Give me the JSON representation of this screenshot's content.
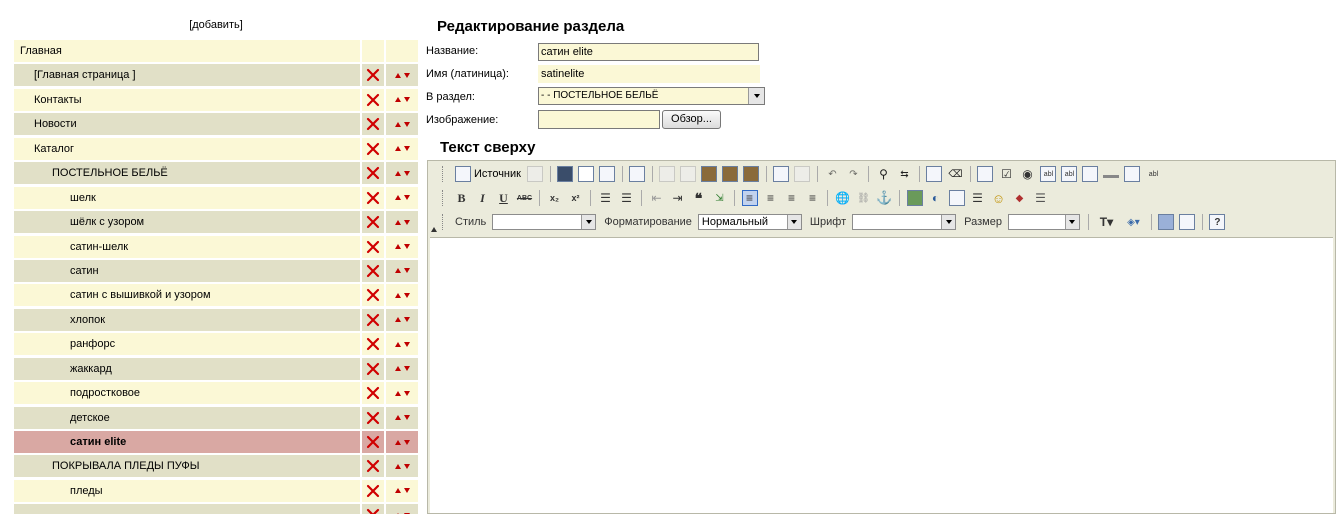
{
  "tree": {
    "add_label": "[добавить]",
    "items": [
      {
        "label": "Главная",
        "indent": 0,
        "tone": "light",
        "controls": false
      },
      {
        "label": "[Главная страница ]",
        "indent": 1,
        "tone": "dark",
        "controls": true
      },
      {
        "label": "Контакты",
        "indent": 1,
        "tone": "light",
        "controls": true
      },
      {
        "label": "Новости",
        "indent": 1,
        "tone": "dark",
        "controls": true
      },
      {
        "label": "Каталог",
        "indent": 1,
        "tone": "light",
        "controls": true
      },
      {
        "label": "ПОСТЕЛЬНОЕ БЕЛЬЁ",
        "indent": 2,
        "tone": "dark",
        "controls": true
      },
      {
        "label": "шелк",
        "indent": 3,
        "tone": "light",
        "controls": true
      },
      {
        "label": "шёлк с узором",
        "indent": 3,
        "tone": "dark",
        "controls": true
      },
      {
        "label": "сатин-шелк",
        "indent": 3,
        "tone": "light",
        "controls": true
      },
      {
        "label": "сатин",
        "indent": 3,
        "tone": "dark",
        "controls": true
      },
      {
        "label": "сатин с вышивкой и узором",
        "indent": 3,
        "tone": "light",
        "controls": true
      },
      {
        "label": "хлопок",
        "indent": 3,
        "tone": "dark",
        "controls": true
      },
      {
        "label": "ранфорс",
        "indent": 3,
        "tone": "light",
        "controls": true
      },
      {
        "label": "жаккард",
        "indent": 3,
        "tone": "dark",
        "controls": true
      },
      {
        "label": "подростковое",
        "indent": 3,
        "tone": "light",
        "controls": true
      },
      {
        "label": "детское",
        "indent": 3,
        "tone": "dark",
        "controls": true
      },
      {
        "label": "сатин elite",
        "indent": 3,
        "tone": "selected",
        "controls": true
      },
      {
        "label": "ПОКРЫВАЛА ПЛЕДЫ ПУФЫ",
        "indent": 2,
        "tone": "dark",
        "controls": true
      },
      {
        "label": "пледы",
        "indent": 3,
        "tone": "light",
        "controls": true
      },
      {
        "label": "",
        "indent": 3,
        "tone": "dark",
        "controls": true
      }
    ]
  },
  "form": {
    "title": "Редактирование раздела",
    "name_label": "Название:",
    "name_value": "сатин  elite",
    "latin_label": "Имя (латиница):",
    "latin_value": "satinelite",
    "section_label": "В раздел:",
    "section_value": "- - ПОСТЕЛЬНОЕ БЕЛЬЁ",
    "image_label": "Изображение:",
    "image_value": "",
    "browse_label": "Обзор...",
    "text_top_label": "Текст сверху"
  },
  "editor": {
    "source_label": "Источник",
    "style_label": "Стиль",
    "style_value": "",
    "format_label": "Форматирование",
    "format_value": "Нормальный",
    "font_label": "Шрифт",
    "font_value": "",
    "size_label": "Размер",
    "size_value": "",
    "bold_glyph": "B",
    "italic_glyph": "I",
    "underline_glyph": "U",
    "strike_glyph": "ABC",
    "sub_glyph": "x₂",
    "sup_glyph": "x²",
    "text_color_glyph": "T",
    "help_glyph": "?",
    "field_glyph": "abl",
    "accent_color": "#316ac5"
  }
}
